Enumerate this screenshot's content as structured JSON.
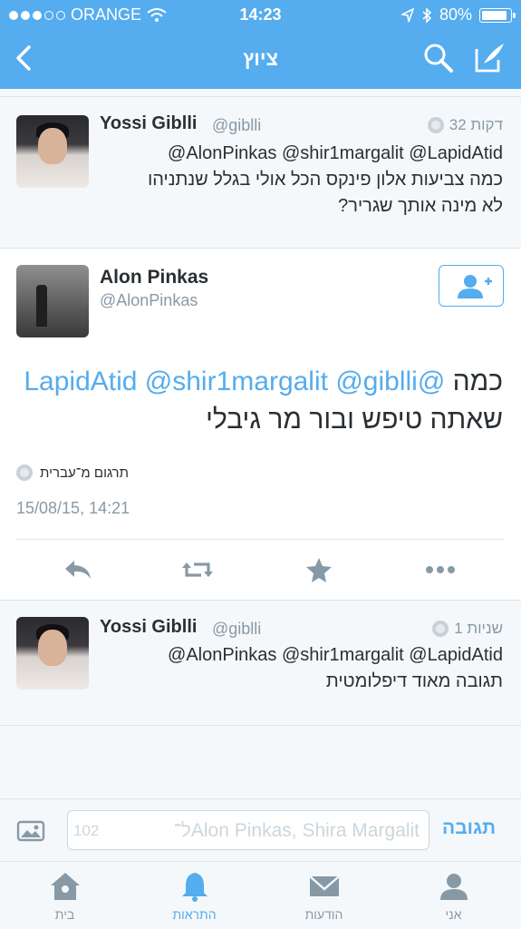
{
  "status_bar": {
    "carrier": "ORANGE",
    "time": "14:23",
    "battery": "80%",
    "signal_bars": 3,
    "battery_level": 0.8
  },
  "nav": {
    "title": "ציוץ",
    "back_icon": "chevron-left-icon",
    "search_icon": "search-icon",
    "compose_icon": "compose-icon"
  },
  "reply_above": {
    "name": "Yossi Giblli",
    "handle": "@giblli",
    "time": "32 דקות",
    "line1": "@AlonPinkas @shir1margalit @LapidAtid",
    "line2": "כמה צביעות אלון פינקס הכל אולי בגלל שנתניהו",
    "line3": "לא מינה אותך שגריר?"
  },
  "main_tweet": {
    "name": "Alon Pinkas",
    "handle": "@AlonPinkas",
    "text_word": "כמה",
    "mention1": "@LapidAtid",
    "mention2": "@shir1margalit",
    "mention3": "@giblli",
    "text_line2": "שאתה טיפש ובור מר גיבלי",
    "translate": "תרגום מ־עברית",
    "date": "15/08/15, 14:21"
  },
  "reply_below": {
    "name": "Yossi Giblli",
    "handle": "@giblli",
    "time": "1 שניות",
    "line1": "@AlonPinkas @shir1margalit @LapidAtid",
    "line2": "תגובה מאוד דיפלומטית"
  },
  "reply_bar": {
    "placeholder": "ל־Alon Pinkas, Shira Margalit",
    "count": "102",
    "button": "תגובה"
  },
  "tabs": [
    {
      "label": "בית",
      "icon": "home-icon"
    },
    {
      "label": "התראות",
      "icon": "bell-icon",
      "active": true
    },
    {
      "label": "הודעות",
      "icon": "envelope-icon"
    },
    {
      "label": "אני",
      "icon": "user-icon"
    }
  ],
  "colors": {
    "accent": "#55acee",
    "text": "#292f33",
    "muted": "#8899a6"
  }
}
